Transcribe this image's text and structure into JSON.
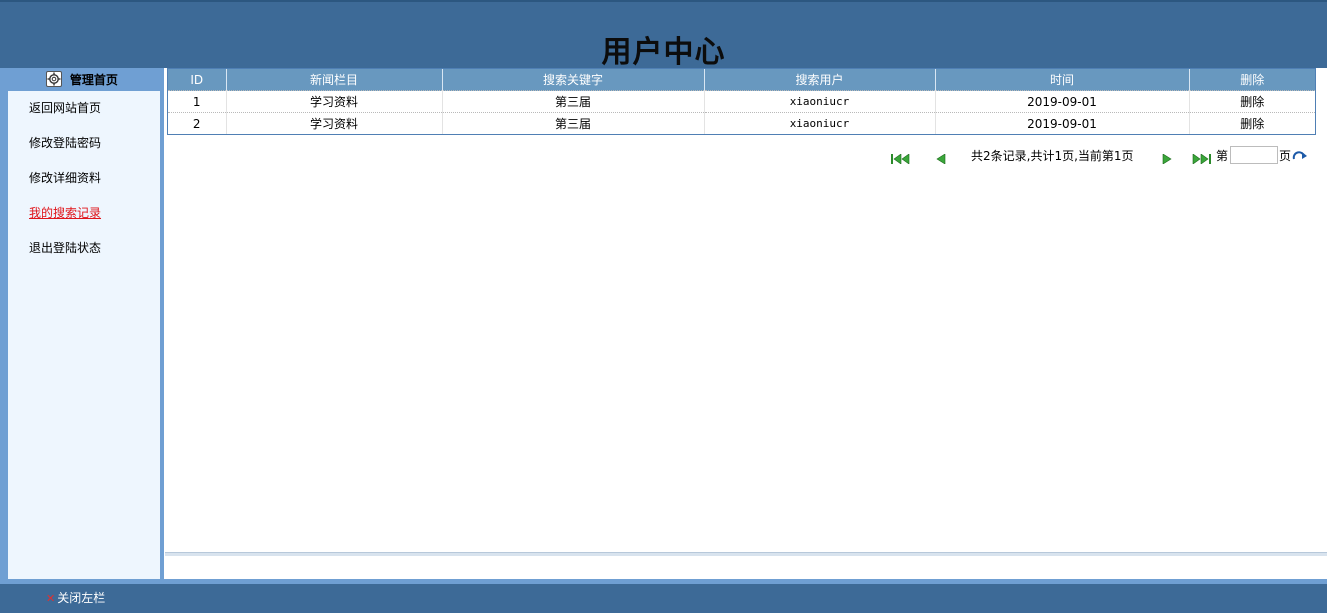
{
  "header": {
    "title": "用户中心"
  },
  "sidebar": {
    "head_label": "管理首页",
    "items": [
      {
        "label": "返回网站首页"
      },
      {
        "label": "修改登陆密码"
      },
      {
        "label": "修改详细资料"
      },
      {
        "label": "我的搜索记录",
        "active": true
      },
      {
        "label": "退出登陆状态"
      }
    ]
  },
  "table": {
    "columns": [
      "ID",
      "新闻栏目",
      "搜索关键字",
      "搜索用户",
      "时间",
      "删除"
    ],
    "rows": [
      {
        "id": "1",
        "category": "学习资料",
        "keyword": "第三届",
        "user": "xiaoniucr",
        "time": "2019-09-01",
        "delete": "删除"
      },
      {
        "id": "2",
        "category": "学习资料",
        "keyword": "第三届",
        "user": "xiaoniucr",
        "time": "2019-09-01",
        "delete": "删除"
      }
    ]
  },
  "pager": {
    "info": "共2条记录,共计1页,当前第1页",
    "goto_prefix": "第",
    "goto_suffix": "页",
    "goto_value": ""
  },
  "footer": {
    "close_label": "关闭左栏"
  },
  "colors": {
    "header_bg": "#3d6a97",
    "sidebar_bg": "#6f9fd3",
    "sidebar_panel": "#eef6fe",
    "table_head": "#6898bf",
    "active_link": "#e0141a"
  }
}
